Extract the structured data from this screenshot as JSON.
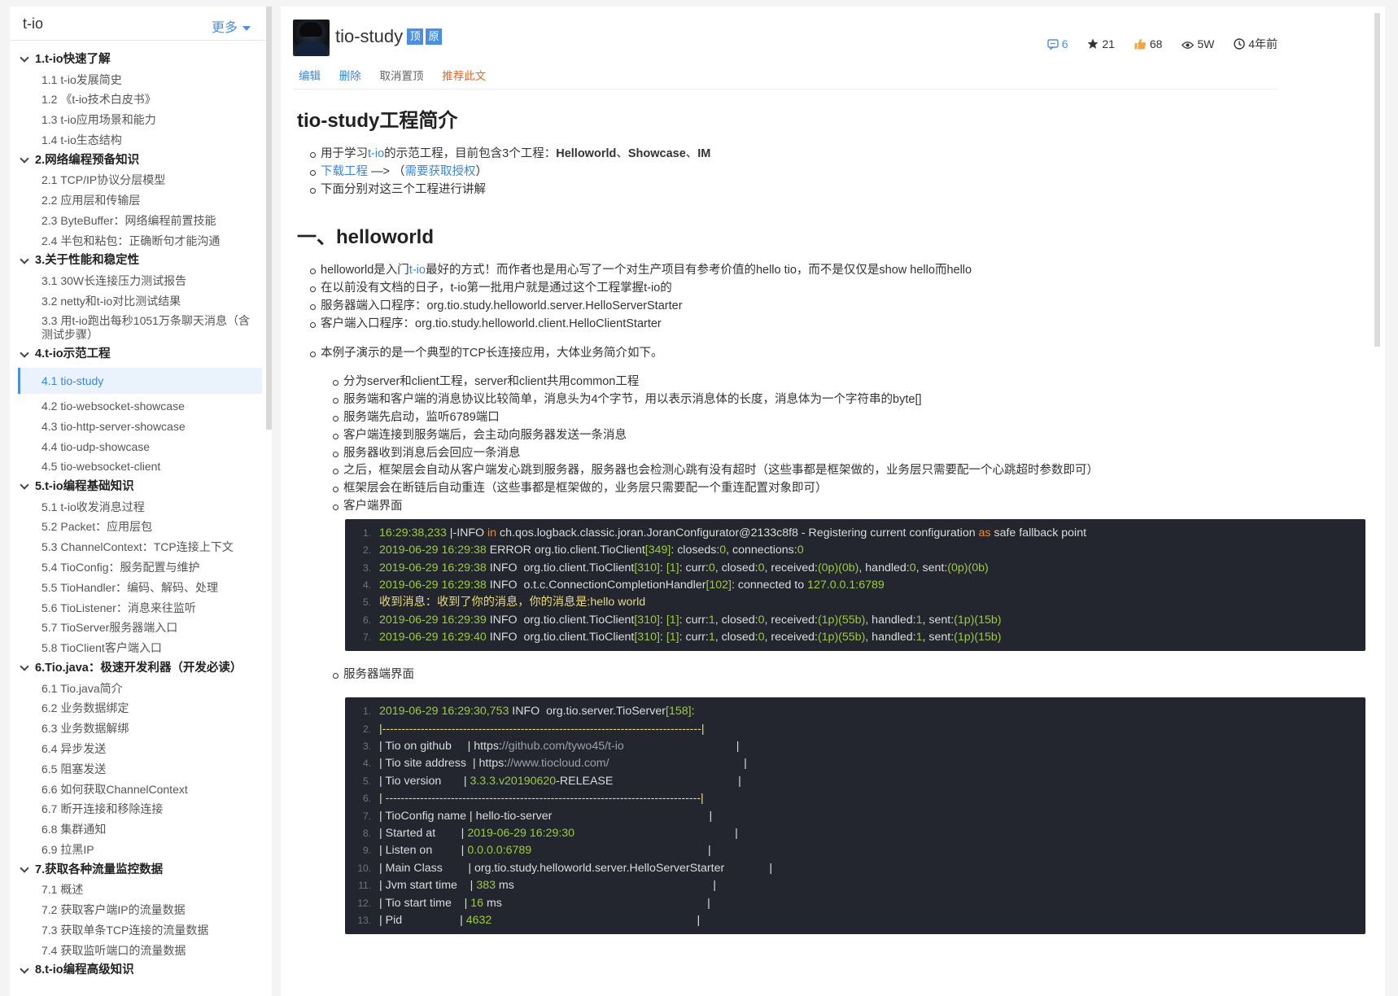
{
  "sidebar": {
    "title": "t-io",
    "more_label": "更多",
    "sections": [
      {
        "label": "1.t-io快速了解",
        "items": [
          "1.1 t-io发展简史",
          "1.2 《t-io技术白皮书》",
          "1.3 t-io应用场景和能力",
          "1.4 t-io生态结构"
        ]
      },
      {
        "label": "2.网络编程预备知识",
        "items": [
          "2.1 TCP/IP协议分层模型",
          "2.2 应用层和传输层",
          "2.3 ByteBuffer：网络编程前置技能",
          "2.4 半包和粘包：正确断句才能沟通"
        ]
      },
      {
        "label": "3.关于性能和稳定性",
        "items": [
          "3.1 30W长连接压力测试报告",
          "3.2 netty和t-io对比测试结果",
          "3.3 用t-io跑出每秒1051万条聊天消息（含测试步骤）"
        ]
      },
      {
        "label": "4.t-io示范工程",
        "items": [
          "4.1 tio-study",
          "4.2 tio-websocket-showcase",
          "4.3 tio-http-server-showcase",
          "4.4 tio-udp-showcase",
          "4.5 tio-websocket-client"
        ]
      },
      {
        "label": "5.t-io编程基础知识",
        "items": [
          "5.1 t-io收发消息过程",
          "5.2 Packet：应用层包",
          "5.3 ChannelContext：TCP连接上下文",
          "5.4 TioConfig：服务配置与维护",
          "5.5 TioHandler：编码、解码、处理",
          "5.6 TioListener：消息来往监听",
          "5.7 TioServer服务器端入口",
          "5.8 TioClient客户端入口"
        ]
      },
      {
        "label": "6.Tio.java：极速开发利器（开发必读）",
        "items": [
          "6.1 Tio.java简介",
          "6.2 业务数据绑定",
          "6.3 业务数据解绑",
          "6.4 异步发送",
          "6.5 阻塞发送",
          "6.6 如何获取ChannelContext",
          "6.7 断开连接和移除连接",
          "6.8 集群通知",
          "6.9 拉黑IP"
        ]
      },
      {
        "label": "7.获取各种流量监控数据",
        "items": [
          "7.1 概述",
          "7.2 获取客户端IP的流量数据",
          "7.3 获取单条TCP连接的流量数据",
          "7.4 获取监听端口的流量数据"
        ]
      },
      {
        "label": "8.t-io编程高级知识",
        "items": []
      }
    ],
    "active_item": "4.1 tio-study"
  },
  "header": {
    "title": "tio-study",
    "tag_top": "顶",
    "tag_original": "原",
    "actions": {
      "edit": "编辑",
      "delete": "删除",
      "unpin": "取消置顶",
      "recommend": "推荐此文"
    },
    "stats": {
      "comments": "6",
      "stars": "21",
      "likes": "68",
      "views": "5W",
      "time": "4年前"
    }
  },
  "doc": {
    "title": "tio-study工程简介",
    "intro": {
      "b1_pre": "用于学习",
      "b1_link": "t-io",
      "b1_mid": "的示范工程，目前包含3个工程：",
      "b1_p1": "Helloworld",
      "b1_sep1": "、",
      "b1_p2": "Showcase",
      "b1_sep2": "、",
      "b1_p3": "IM",
      "b2_link1": "下载工程",
      "b2_arrow": " —> （",
      "b2_link2": "需要获取授权",
      "b2_end": "）",
      "b3": "下面分别对这三个工程进行讲解"
    },
    "section1_title": "一、helloworld",
    "hw": {
      "b1_pre": "helloworld是入门",
      "b1_link": "t-io",
      "b1_post": "最好的方式！而作者也是用心写了一个对生产项目有参考价值的hello tio，而不是仅仅是show hello而hello",
      "b2": "在以前没有文档的日子，t-io第一批用户就是通过这个工程掌握t-io的",
      "b3": "服务器端入口程序：org.tio.study.helloworld.server.HelloServerStarter",
      "b4": "客户端入口程序：org.tio.study.helloworld.client.HelloClientStarter",
      "b5": "本例子演示的是一个典型的TCP长连接应用，大体业务简介如下。",
      "sub": [
        "分为server和client工程，server和client共用common工程",
        "服务端和客户端的消息协议比较简单，消息头为4个字节，用以表示消息体的长度，消息体为一个字符串的byte[]",
        "服务端先启动，监听6789端口",
        "客户端连接到服务端后，会主动向服务器发送一条消息",
        "服务器收到消息后会回应一条消息",
        "之后，框架层会自动从客户端发心跳到服务器，服务器也会检测心跳有没有超时（这些事都是框架做的，业务层只需要配一个心跳超时参数即可）",
        "框架层会在断链后自动重连（这些事都是框架做的，业务层只需要配一个重连配置对象即可）",
        "客户端界面"
      ],
      "server_label": "服务器端界面"
    },
    "client_log": [
      [
        [
          "16:29:38,233",
          "g"
        ],
        [
          " |-INFO ",
          "w"
        ],
        [
          "in",
          "o"
        ],
        [
          " ch.qos.logback.classic.joran.JoranConfigurator@2133c8f8 - Registering current configuration ",
          "w"
        ],
        [
          "as",
          "o"
        ],
        [
          " safe fallback point",
          "w"
        ]
      ],
      [
        [
          "2019-06-29 16:29:38",
          "g"
        ],
        [
          " ERROR org.tio.client.TioClient",
          "w"
        ],
        [
          "[349]",
          "g"
        ],
        [
          ": closeds:",
          "w"
        ],
        [
          "0",
          "g"
        ],
        [
          ", connections:",
          "w"
        ],
        [
          "0",
          "g"
        ]
      ],
      [
        [
          "2019-06-29 16:29:38",
          "g"
        ],
        [
          " INFO  org.tio.client.TioClient",
          "w"
        ],
        [
          "[310]",
          "g"
        ],
        [
          ": ",
          "w"
        ],
        [
          "[1]",
          "g"
        ],
        [
          ": curr:",
          "w"
        ],
        [
          "0",
          "g"
        ],
        [
          ", closed:",
          "w"
        ],
        [
          "0",
          "g"
        ],
        [
          ", received:",
          "w"
        ],
        [
          "(0p)(0b)",
          "g"
        ],
        [
          ", handled:",
          "w"
        ],
        [
          "0",
          "g"
        ],
        [
          ", sent:",
          "w"
        ],
        [
          "(0p)(0b)",
          "g"
        ]
      ],
      [
        [
          "2019-06-29 16:29:38",
          "g"
        ],
        [
          " INFO  o.t.c.ConnectionCompletionHandler",
          "w"
        ],
        [
          "[102]",
          "g"
        ],
        [
          ": connected to ",
          "w"
        ],
        [
          "127.0.0.1:6789",
          "g"
        ]
      ],
      [
        [
          "收到消息：收到了你的消息，你的消息是:hello world",
          "y"
        ]
      ],
      [
        [
          "2019-06-29 16:29:39",
          "g"
        ],
        [
          " INFO  org.tio.client.TioClient",
          "w"
        ],
        [
          "[310]",
          "g"
        ],
        [
          ": ",
          "w"
        ],
        [
          "[1]",
          "g"
        ],
        [
          ": curr:",
          "w"
        ],
        [
          "1",
          "g"
        ],
        [
          ", closed:",
          "w"
        ],
        [
          "0",
          "g"
        ],
        [
          ", received:",
          "w"
        ],
        [
          "(1p)(55b)",
          "g"
        ],
        [
          ", handled:",
          "w"
        ],
        [
          "1",
          "g"
        ],
        [
          ", sent:",
          "w"
        ],
        [
          "(1p)(15b)",
          "g"
        ]
      ],
      [
        [
          "2019-06-29 16:29:40",
          "g"
        ],
        [
          " INFO  org.tio.client.TioClient",
          "w"
        ],
        [
          "[310]",
          "g"
        ],
        [
          ": ",
          "w"
        ],
        [
          "[1]",
          "g"
        ],
        [
          ": curr:",
          "w"
        ],
        [
          "1",
          "g"
        ],
        [
          ", closed:",
          "w"
        ],
        [
          "0",
          "g"
        ],
        [
          ", received:",
          "w"
        ],
        [
          "(1p)(55b)",
          "g"
        ],
        [
          ", handled:",
          "w"
        ],
        [
          "1",
          "g"
        ],
        [
          ", sent:",
          "w"
        ],
        [
          "(1p)(15b)",
          "g"
        ]
      ]
    ],
    "server_log": [
      [
        [
          "2019-06-29 16:29:30,753",
          "g"
        ],
        [
          " INFO  org.tio.server.TioServer",
          "w"
        ],
        [
          "[158]",
          "g"
        ],
        [
          ":",
          "w"
        ]
      ],
      [
        [
          "|-----------------------------------------------------------------------------------|",
          "y"
        ]
      ],
      [
        [
          "| Tio on github     | https:",
          "w"
        ],
        [
          "//github.com/tywo45/t-io",
          "dim"
        ],
        [
          "                                   |",
          "w"
        ]
      ],
      [
        [
          "| Tio site address  | https:",
          "w"
        ],
        [
          "//www.tiocloud.com/",
          "dim"
        ],
        [
          "                                          |",
          "w"
        ]
      ],
      [
        [
          "| Tio version       | ",
          "w"
        ],
        [
          "3.3.3.v20190620",
          "g"
        ],
        [
          "-RELEASE                                       |",
          "w"
        ]
      ],
      [
        [
          "| ----------------------------------------------------------------------------------|",
          "y"
        ]
      ],
      [
        [
          "| TioConfig name | hello-tio-server                                                 |",
          "w"
        ]
      ],
      [
        [
          "| Started at        | ",
          "w"
        ],
        [
          "2019-06-29 16:29:30",
          "g"
        ],
        [
          "                                                  |",
          "w"
        ]
      ],
      [
        [
          "| Listen on         | ",
          "w"
        ],
        [
          "0.0.0.0:6789",
          "g"
        ],
        [
          "                                                       |",
          "w"
        ]
      ],
      [
        [
          "| Main Class        | org.tio.study.helloworld.server.HelloServerStarter              |",
          "w"
        ]
      ],
      [
        [
          "| Jvm start time    | ",
          "w"
        ],
        [
          "383",
          "g"
        ],
        [
          " ms                                                              |",
          "w"
        ]
      ],
      [
        [
          "| Tio start time    | ",
          "w"
        ],
        [
          "16",
          "g"
        ],
        [
          " ms                                                                |",
          "w"
        ]
      ],
      [
        [
          "| Pid                  | ",
          "w"
        ],
        [
          "4632",
          "g"
        ],
        [
          "                                                                |",
          "w"
        ]
      ]
    ]
  },
  "colors": {
    "accent": "#4a8fe2",
    "orange": "#e4672d",
    "code_bg": "#23262e",
    "code_green": "#9ccc3c"
  }
}
